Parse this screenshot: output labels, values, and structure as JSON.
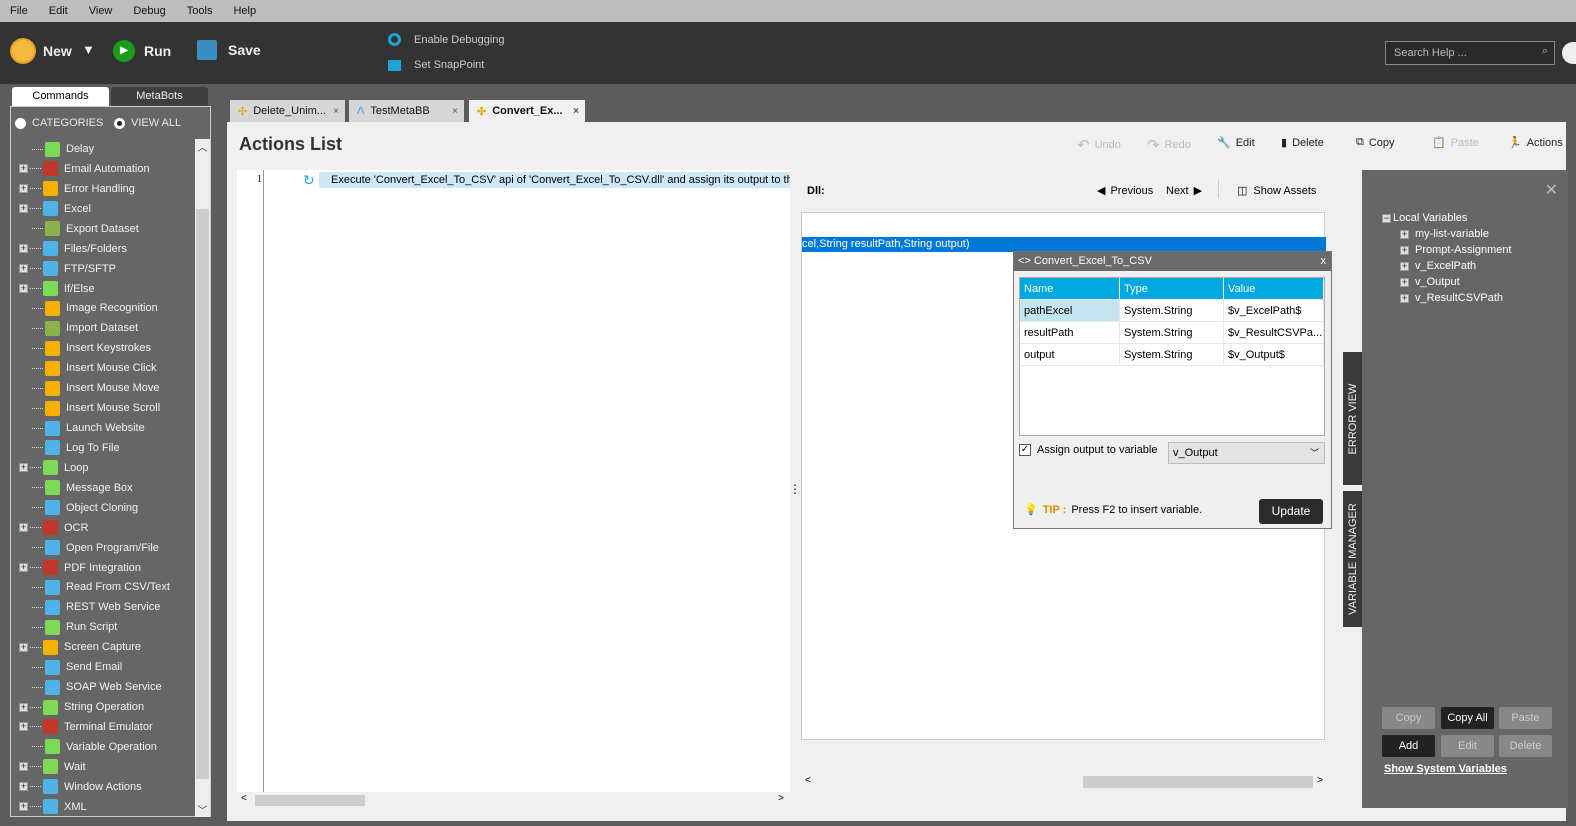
{
  "menu": [
    "File",
    "Edit",
    "View",
    "Debug",
    "Tools",
    "Help"
  ],
  "toolbar": {
    "new": "New",
    "run": "Run",
    "save": "Save",
    "enable_debugging": "Enable Debugging",
    "set_snappoint": "Set SnapPoint",
    "search_placeholder": "Search Help ..."
  },
  "left": {
    "tabs": [
      "Commands",
      "MetaBots"
    ],
    "categories": "CATEGORIES",
    "view_all": "VIEW ALL",
    "commands": [
      {
        "label": "Delay",
        "exp": false,
        "color": "#7ed957"
      },
      {
        "label": "Email Automation",
        "exp": true,
        "color": "#c0392b"
      },
      {
        "label": "Error Handling",
        "exp": true,
        "color": "#f5b000"
      },
      {
        "label": "Excel",
        "exp": true,
        "color": "#4fb3e8"
      },
      {
        "label": "Export Dataset",
        "exp": false,
        "color": "#8bb34a"
      },
      {
        "label": "Files/Folders",
        "exp": true,
        "color": "#4fb3e8"
      },
      {
        "label": "FTP/SFTP",
        "exp": true,
        "color": "#4fb3e8"
      },
      {
        "label": "If/Else",
        "exp": true,
        "color": "#7ed957"
      },
      {
        "label": "Image Recognition",
        "exp": false,
        "color": "#f5b000"
      },
      {
        "label": "Import Dataset",
        "exp": false,
        "color": "#8bb34a"
      },
      {
        "label": "Insert Keystrokes",
        "exp": false,
        "color": "#f5b000"
      },
      {
        "label": "Insert Mouse Click",
        "exp": false,
        "color": "#f5b000"
      },
      {
        "label": "Insert Mouse Move",
        "exp": false,
        "color": "#f5b000"
      },
      {
        "label": "Insert Mouse Scroll",
        "exp": false,
        "color": "#f5b000"
      },
      {
        "label": "Launch Website",
        "exp": false,
        "color": "#4fb3e8"
      },
      {
        "label": "Log To File",
        "exp": false,
        "color": "#4fb3e8"
      },
      {
        "label": "Loop",
        "exp": true,
        "color": "#7ed957"
      },
      {
        "label": "Message Box",
        "exp": false,
        "color": "#7ed957"
      },
      {
        "label": "Object Cloning",
        "exp": false,
        "color": "#4fb3e8"
      },
      {
        "label": "OCR",
        "exp": true,
        "color": "#c0392b"
      },
      {
        "label": "Open Program/File",
        "exp": false,
        "color": "#4fb3e8"
      },
      {
        "label": "PDF Integration",
        "exp": true,
        "color": "#c0392b"
      },
      {
        "label": "Read From CSV/Text",
        "exp": false,
        "color": "#4fb3e8"
      },
      {
        "label": "REST Web Service",
        "exp": false,
        "color": "#4fb3e8"
      },
      {
        "label": "Run Script",
        "exp": false,
        "color": "#7ed957"
      },
      {
        "label": "Screen Capture",
        "exp": true,
        "color": "#f5b000"
      },
      {
        "label": "Send Email",
        "exp": false,
        "color": "#4fb3e8"
      },
      {
        "label": "SOAP Web Service",
        "exp": false,
        "color": "#4fb3e8"
      },
      {
        "label": "String Operation",
        "exp": true,
        "color": "#7ed957"
      },
      {
        "label": "Terminal Emulator",
        "exp": true,
        "color": "#c0392b"
      },
      {
        "label": "Variable Operation",
        "exp": false,
        "color": "#7ed957"
      },
      {
        "label": "Wait",
        "exp": true,
        "color": "#7ed957"
      },
      {
        "label": "Window Actions",
        "exp": true,
        "color": "#4fb3e8"
      },
      {
        "label": "XML",
        "exp": true,
        "color": "#4fb3e8"
      }
    ]
  },
  "doc_tabs": [
    "Delete_Unim...",
    "TestMetaBB",
    "Convert_Ex..."
  ],
  "actions": {
    "title": "Actions List",
    "undo": "Undo",
    "redo": "Redo",
    "edit": "Edit",
    "delete": "Delete",
    "copy": "Copy",
    "paste": "Paste",
    "actions": "Actions",
    "line_number": "1",
    "line_text": "Execute 'Convert_Excel_To_CSV' api of 'Convert_Excel_To_CSV.dll' and assign its output to the"
  },
  "dll": {
    "label": "Dll:",
    "previous": "Previous",
    "next": "Next",
    "show_assets": "Show Assets",
    "signature": "cel,String resultPath,String output)"
  },
  "dialog": {
    "title": "<> Convert_Excel_To_CSV",
    "close": "x",
    "headers": [
      "Name",
      "Type",
      "Value"
    ],
    "rows": [
      [
        "pathExcel",
        "System.String",
        "$v_ExcelPath$"
      ],
      [
        "resultPath",
        "System.String",
        "$v_ResultCSVPa..."
      ],
      [
        "output",
        "System.String",
        "$v_Output$"
      ]
    ],
    "assign_label": "Assign output to variable",
    "assign_value": "v_Output",
    "tip_label": "TIP :",
    "tip_text": "Press F2 to insert variable.",
    "update": "Update"
  },
  "side_tabs": [
    "ERROR VIEW",
    "VARIABLE MANAGER"
  ],
  "variables": {
    "root": "Local Variables",
    "items": [
      "my-list-variable",
      "Prompt-Assignment",
      "v_ExcelPath",
      "v_Output",
      "v_ResultCSVPath"
    ],
    "copy": "Copy",
    "copy_all": "Copy All",
    "paste": "Paste",
    "add": "Add",
    "edit": "Edit",
    "delete": "Delete",
    "show_system": "Show System Variables"
  }
}
